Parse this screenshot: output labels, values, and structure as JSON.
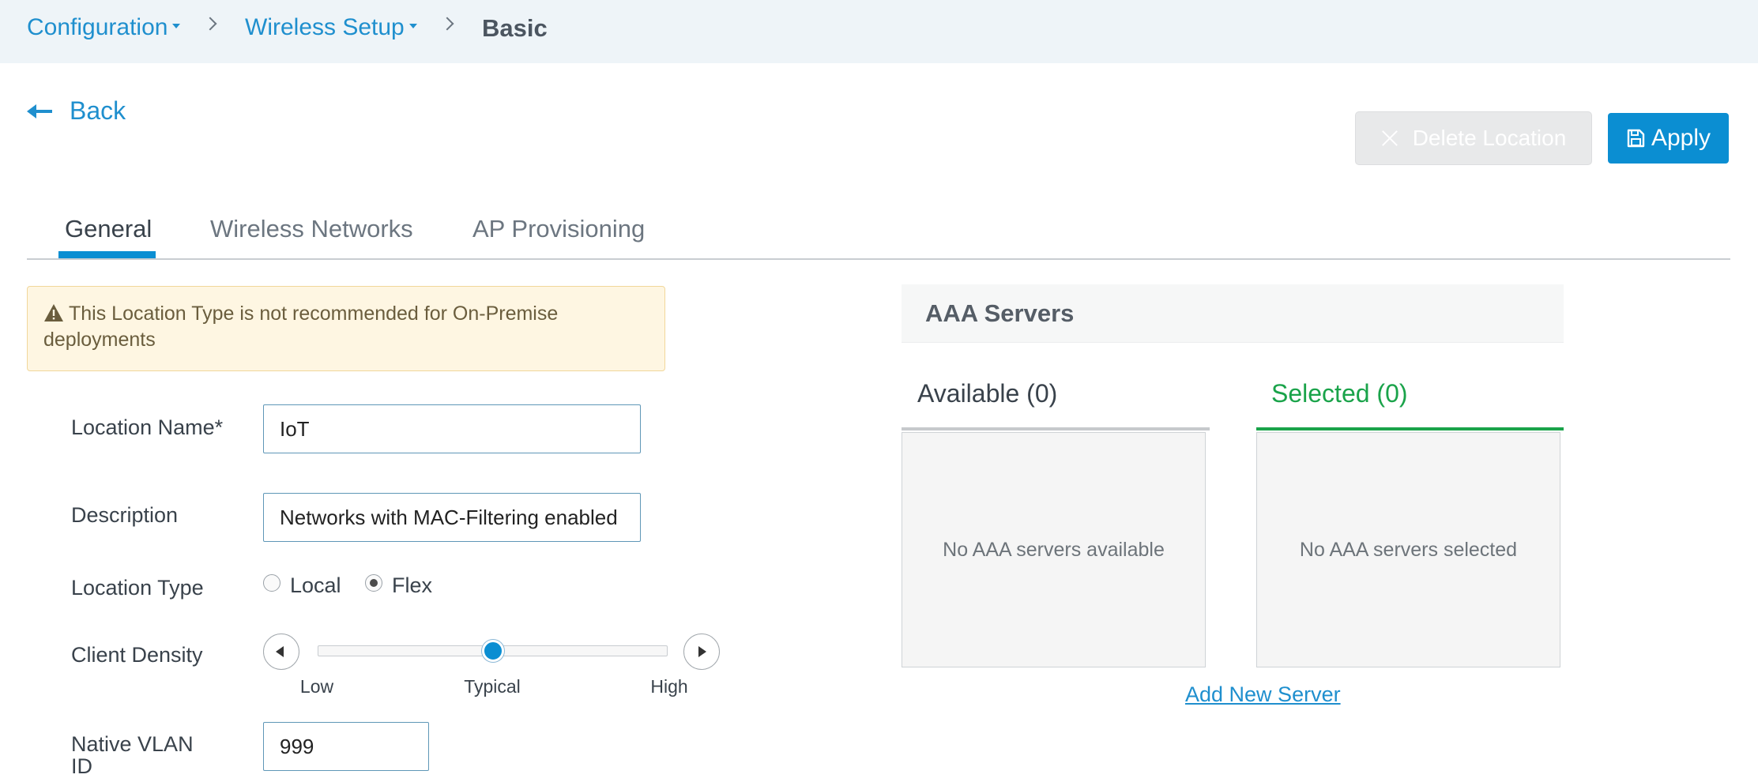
{
  "breadcrumb": {
    "items": [
      {
        "label": "Configuration"
      },
      {
        "label": "Wireless Setup"
      }
    ],
    "current": "Basic"
  },
  "back_label": "Back",
  "actions": {
    "delete_label": "Delete Location",
    "apply_label": "Apply"
  },
  "tabs": [
    {
      "label": "General",
      "active": true
    },
    {
      "label": "Wireless Networks",
      "active": false
    },
    {
      "label": "AP Provisioning",
      "active": false
    }
  ],
  "warning": {
    "text": "This Location Type is not recommended for On-Premise deployments"
  },
  "form": {
    "location_name": {
      "label": "Location Name*",
      "value": "IoT"
    },
    "description": {
      "label": "Description",
      "value": "Networks with MAC-Filtering enabled"
    },
    "location_type": {
      "label": "Location Type",
      "options": [
        {
          "label": "Local",
          "checked": false
        },
        {
          "label": "Flex",
          "checked": true
        }
      ]
    },
    "client_density": {
      "label": "Client Density",
      "ticks": [
        "Low",
        "Typical",
        "High"
      ],
      "selected": "Typical",
      "level": 0.5
    },
    "native_vlan": {
      "label": "Native VLAN ID",
      "value": "999"
    }
  },
  "aaa": {
    "title": "AAA Servers",
    "available": {
      "title": "Available (0)",
      "empty": "No AAA servers available"
    },
    "selected": {
      "title": "Selected (0)",
      "empty": "No AAA servers selected"
    },
    "add_link": "Add New Server"
  },
  "colors": {
    "accent": "#0b8ed2",
    "link": "#1f8fce",
    "selected_green": "#1aa34a",
    "warning_bg": "#fef6e2"
  }
}
